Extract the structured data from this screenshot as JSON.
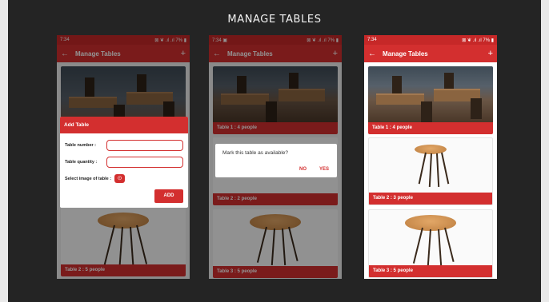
{
  "page_title": "MANAGE TABLES",
  "phones": [
    {
      "status_time": "7:34",
      "status_icons": "⊠ ❦ .ıl .ıl 7% ▮",
      "appbar_title": "Manage Tables",
      "back_icon": "arrow-left-icon",
      "add_icon": "plus-icon",
      "cards": [
        "",
        "Table 2 : 5 people"
      ],
      "dialog": {
        "title": "Add Table",
        "number_label": "Table number :",
        "number_value": "",
        "quantity_label": "Table quantity :",
        "quantity_value": "",
        "image_label": "Select image of table :",
        "image_icon": "image-picker-icon",
        "add_label": "ADD"
      }
    },
    {
      "status_time": "7:34 ▣",
      "status_icons": "⊠ ❦ .ıl .ıl 7% ▮",
      "appbar_title": "Manage Tables",
      "back_icon": "arrow-left-icon",
      "add_icon": "plus-icon",
      "cards": [
        "Table 1 : 4 people",
        "Table 2 : 2 people",
        "Table 3 : 5 people"
      ],
      "dialog": {
        "message": "Mark this table as available?",
        "no_label": "NO",
        "yes_label": "YES"
      }
    },
    {
      "status_time": "7:34",
      "status_icons": "⊠ ❦ .ıl .ıl 7% ▮",
      "appbar_title": "Manage Tables",
      "back_icon": "arrow-left-icon",
      "add_icon": "plus-icon",
      "cards": [
        "Table 1 : 4 people",
        "Table 2 : 3 people",
        "Table 3 : 5 people"
      ]
    }
  ],
  "colors": {
    "primary": "#d32f2f",
    "status_bar": "#c62828",
    "background": "#242424"
  }
}
